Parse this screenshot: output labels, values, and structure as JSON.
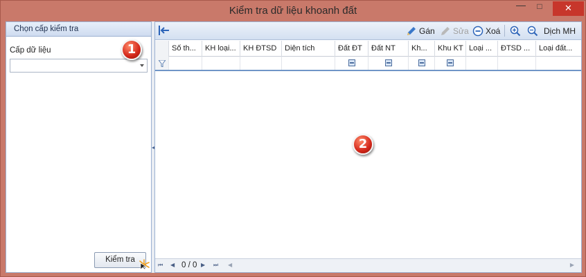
{
  "window": {
    "title": "Kiểm tra dữ liệu khoanh đất",
    "minimize": "—",
    "maximize": "□",
    "close": "✕"
  },
  "left_panel": {
    "header": "Chọn cấp kiểm tra",
    "data_level_label": "Cấp dữ liệu",
    "data_level_value": "",
    "check_button": "Kiểm tra"
  },
  "toolbar": {
    "assign": "Gán",
    "edit": "Sửa",
    "delete": "Xoá",
    "zoom_in_icon": "zoom-in-icon",
    "zoom_out_icon": "zoom-out-icon",
    "translate": "Dịch MH"
  },
  "grid": {
    "columns": [
      "Số th...",
      "KH loại...",
      "KH ĐTSD",
      "Diện tích",
      "Đất ĐT",
      "Đất NT",
      "Kh...",
      "Khu KT",
      "Loại ...",
      "ĐTSD ...",
      "Loại đất..."
    ],
    "rows": []
  },
  "pager": {
    "info": "0 / 0"
  },
  "annotations": {
    "badge1": "1",
    "badge2": "2"
  },
  "colors": {
    "accent": "#c7362b",
    "header_blue": "#cfdcf0",
    "badge_red": "#d3271a"
  }
}
